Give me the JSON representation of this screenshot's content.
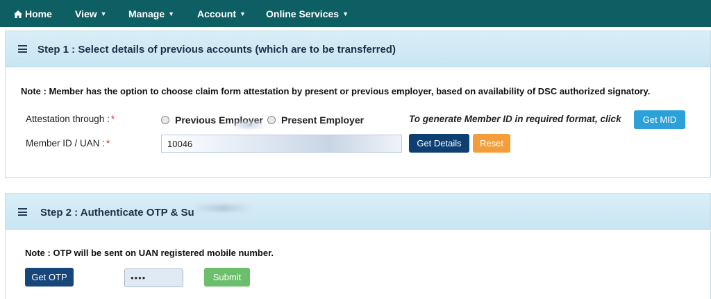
{
  "nav": {
    "home": "Home",
    "view": "View",
    "manage": "Manage",
    "account": "Account",
    "online_services": "Online Services"
  },
  "step1": {
    "title": "Step 1 : Select details of previous accounts (which are to be transferred)",
    "note": "Note : Member has the option to choose claim form attestation by present or previous employer, based on availability of DSC authorized signatory.",
    "attestation_label": "Attestation through :",
    "required_mark": "*",
    "radio_previous": "Previous Employer",
    "radio_present": "Present Employer",
    "mid_hint": "To generate Member ID in required format, click",
    "get_mid": "Get MID",
    "member_label": "Member ID / UAN :",
    "member_value": "10046",
    "get_details": "Get Details",
    "reset": "Reset"
  },
  "step2": {
    "title": "Step 2 : Authenticate OTP & Su",
    "note": "Note : OTP will be sent on UAN registered mobile number.",
    "get_otp": "Get OTP",
    "otp_value": "••••",
    "submit": "Submit"
  },
  "colors": {
    "navbar": "#0e5f63",
    "panel_header": "#cfe8f5",
    "primary_dark": "#0d3f73",
    "info": "#2ba0d9",
    "warning": "#f49e3b",
    "success": "#5cb85c",
    "required": "#d42a2a"
  },
  "icons": {
    "home": "home-icon",
    "menu": "hamburger-icon",
    "dropdown": "caret-down-icon"
  }
}
